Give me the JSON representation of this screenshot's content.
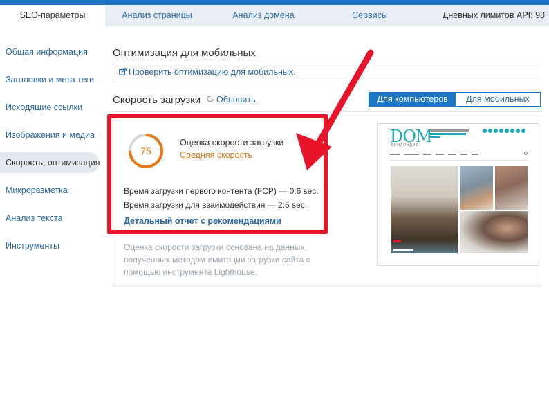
{
  "tabs": [
    {
      "label": "SEO-параметры",
      "active": true
    },
    {
      "label": "Анализ страницы",
      "active": false
    },
    {
      "label": "Анализ домена",
      "active": false
    },
    {
      "label": "Сервисы",
      "active": false
    }
  ],
  "api_limit": "Дневных лимитов API: 93",
  "sidebar": {
    "items": [
      {
        "label": "Общая информация"
      },
      {
        "label": "Заголовки и мета теги"
      },
      {
        "label": "Исходящие ссылки"
      },
      {
        "label": "Изображения и медиа"
      },
      {
        "label": "Скорость, оптимизация",
        "active": true
      },
      {
        "label": "Микроразметка"
      },
      {
        "label": "Анализ текста"
      },
      {
        "label": "Инструменты"
      }
    ]
  },
  "mobile_section": {
    "title": "Оптимизация для мобильных",
    "link": "Проверить оптимизацию для мобильных."
  },
  "speed_section": {
    "title": "Скорость загрузки",
    "refresh": "Обновить",
    "toggle": {
      "desktop": "Для компьютеров",
      "mobile": "Для мобильных"
    },
    "score": 75,
    "score_label": "Оценка скорости загрузки",
    "score_status": "Средняя скорость",
    "fcp": "Время загрузки первого контента (FCP) — 0:6 sec.",
    "tti": "Время загрузки для взаимодействия — 2:5 sec.",
    "report_link": "Детальный отчет с рекомендациями",
    "note": "Оценка скорости загрузки основана на данных, полученных методом имитации загрузки сайта с помощью инструмента Lighthouse."
  },
  "preview": {
    "logo": "DOM",
    "sub": "ФИНЛЯНДИЯ"
  },
  "colors": {
    "accent": "#1c76c5",
    "score": "#e07a1a",
    "highlight": "#e8142a"
  }
}
